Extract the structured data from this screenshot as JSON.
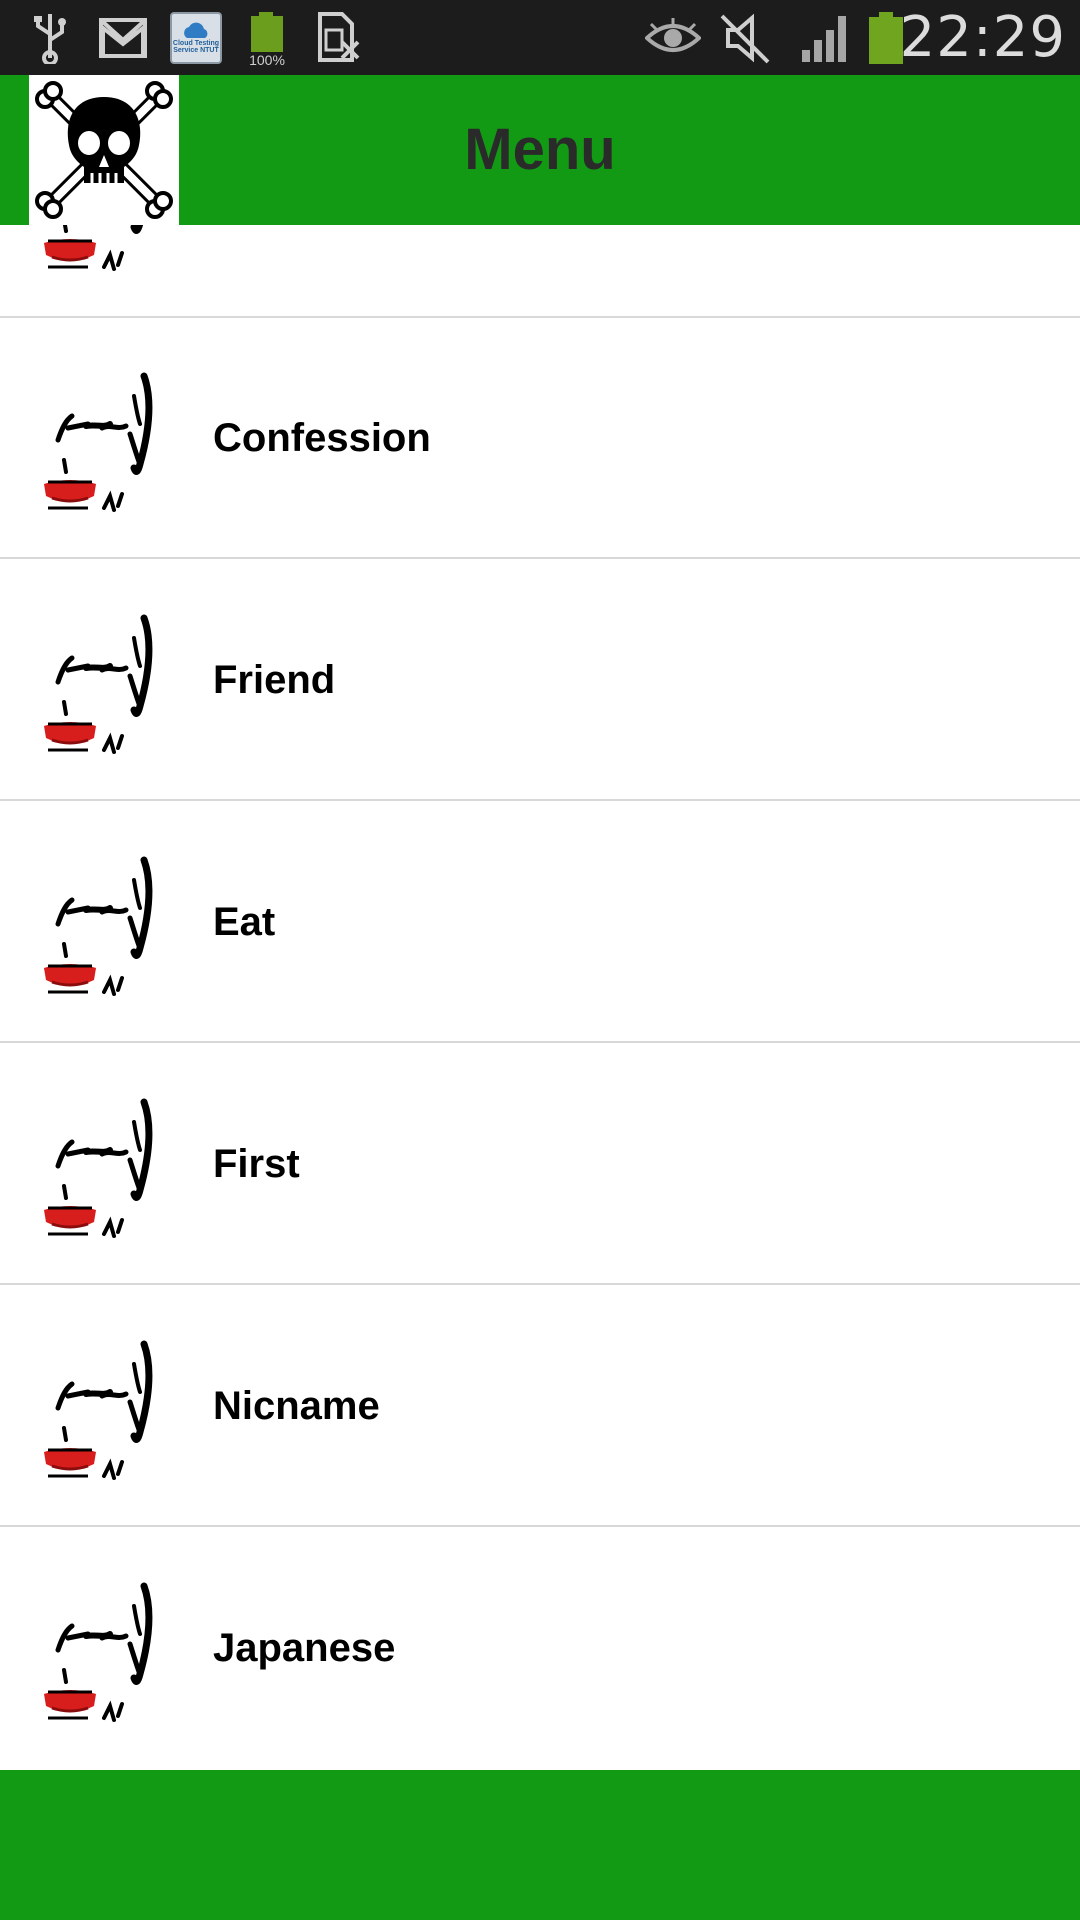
{
  "status_bar": {
    "time": "22:29",
    "battery_small_label": "100%",
    "cloud_app_label": "Cloud Testing Service NTUT",
    "icons": [
      "usb-icon",
      "gmail-icon",
      "cloud-testing-app-icon",
      "battery-app-icon",
      "no-sim-icon",
      "eye-icon",
      "mute-icon",
      "signal-icon",
      "battery-icon"
    ]
  },
  "app_bar": {
    "title": "Menu",
    "logo_icon": "skull-crossbones-icon",
    "color": "#129a14"
  },
  "menu": {
    "items": [
      {
        "label": ""
      },
      {
        "label": "Confession"
      },
      {
        "label": "Friend"
      },
      {
        "label": "Eat"
      },
      {
        "label": "First"
      },
      {
        "label": "Nicname"
      },
      {
        "label": "Japanese"
      }
    ],
    "item_icon": "face-drawing-icon"
  },
  "bottom_bar": {
    "color": "#129a14"
  }
}
